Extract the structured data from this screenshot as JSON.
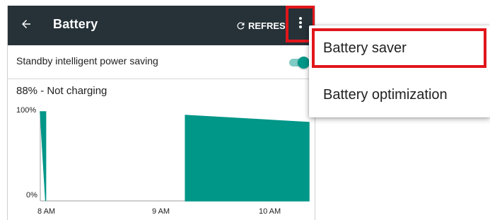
{
  "appbar": {
    "title": "Battery",
    "refresh_label": "REFRESH",
    "icons": {
      "back": "arrow-back-icon",
      "refresh": "refresh-icon",
      "overflow": "more-vert-icon"
    }
  },
  "settings": {
    "standby_label": "Standby intelligent power saving",
    "standby_enabled": true
  },
  "status": {
    "text": "88% - Not charging"
  },
  "chart_data": {
    "type": "area",
    "x_ticks": [
      "8 AM",
      "9 AM",
      "10 AM"
    ],
    "y_ticks": [
      "100%",
      "0%"
    ],
    "ylim": [
      0,
      100
    ],
    "series": [
      {
        "values": [
          [
            0.0,
            100
          ],
          [
            0.02,
            100
          ],
          [
            0.02,
            0
          ]
        ]
      },
      {
        "values": [
          [
            0.54,
            0
          ],
          [
            0.54,
            96
          ],
          [
            1.0,
            88
          ],
          [
            1.0,
            0
          ]
        ]
      }
    ]
  },
  "menu": {
    "items": [
      {
        "label": "Battery saver",
        "highlighted": true
      },
      {
        "label": "Battery optimization",
        "highlighted": false
      }
    ]
  },
  "colors": {
    "appbar": "#263238",
    "accent": "#009688",
    "highlight": "#e0161b"
  }
}
